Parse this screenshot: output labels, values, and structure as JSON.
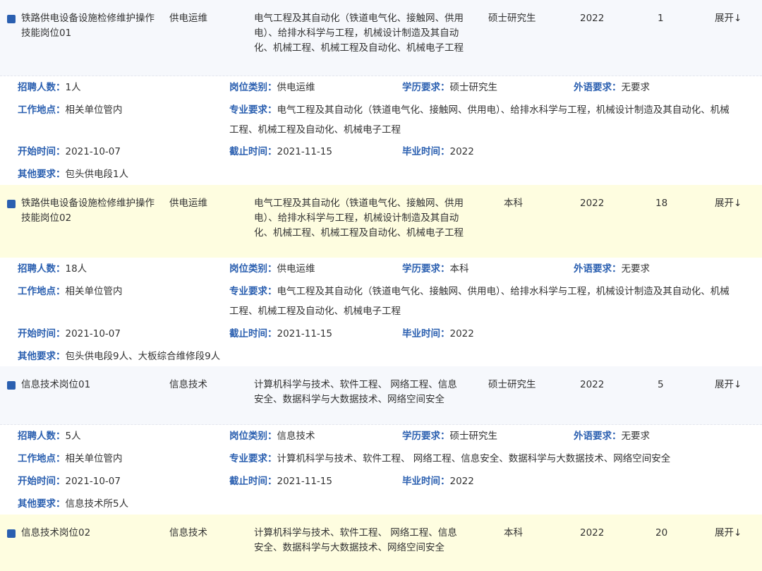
{
  "labels": {
    "recruit_count": "招聘人数：",
    "category": "岗位类别：",
    "education": "学历要求：",
    "foreign_lang": "外语要求：",
    "location": "工作地点：",
    "major": "专业要求：",
    "start": "开始时间：",
    "end": "截止时间：",
    "grad": "毕业时间：",
    "other": "其他要求：",
    "expand": "展开↓"
  },
  "jobs": [
    {
      "name": "铁路供电设备设施检修维护操作技能岗位01",
      "category": "供电运维",
      "major_short": "电气工程及其自动化（铁道电气化、接触网、供用电）、给排水科学与工程，机械设计制造及其自动化、机械工程、机械工程及自动化、机械电子工程",
      "education": "硕士研究生",
      "year": "2022",
      "count": "1",
      "d_count": "1人",
      "d_category": "供电运维",
      "d_education": "硕士研究生",
      "d_lang": "无要求",
      "d_location": "相关单位管内",
      "d_major": "电气工程及其自动化（铁道电气化、接触网、供用电）、给排水科学与工程，机械设计制造及其自动化、机械工程、机械工程及自动化、机械电子工程",
      "d_start": "2021-10-07",
      "d_end": "2021-11-15",
      "d_grad": "2022",
      "d_other": "包头供电段1人"
    },
    {
      "name": "铁路供电设备设施检修维护操作技能岗位02",
      "category": "供电运维",
      "major_short": "电气工程及其自动化（铁道电气化、接触网、供用电）、给排水科学与工程，机械设计制造及其自动化、机械工程、机械工程及自动化、机械电子工程",
      "education": "本科",
      "year": "2022",
      "count": "18",
      "d_count": "18人",
      "d_category": "供电运维",
      "d_education": "本科",
      "d_lang": "无要求",
      "d_location": "相关单位管内",
      "d_major": "电气工程及其自动化（铁道电气化、接触网、供用电）、给排水科学与工程，机械设计制造及其自动化、机械工程、机械工程及自动化、机械电子工程",
      "d_start": "2021-10-07",
      "d_end": "2021-11-15",
      "d_grad": "2022",
      "d_other": "包头供电段9人、大板综合维修段9人"
    },
    {
      "name": "信息技术岗位01",
      "category": "信息技术",
      "major_short": "计算机科学与技术、软件工程、 网络工程、信息安全、数据科学与大数据技术、网络空间安全",
      "education": "硕士研究生",
      "year": "2022",
      "count": "5",
      "d_count": "5人",
      "d_category": "信息技术",
      "d_education": "硕士研究生",
      "d_lang": "无要求",
      "d_location": "相关单位管内",
      "d_major": "计算机科学与技术、软件工程、 网络工程、信息安全、数据科学与大数据技术、网络空间安全",
      "d_start": "2021-10-07",
      "d_end": "2021-11-15",
      "d_grad": "2022",
      "d_other": "信息技术所5人"
    },
    {
      "name": "信息技术岗位02",
      "category": "信息技术",
      "major_short": "计算机科学与技术、软件工程、 网络工程、信息安全、数据科学与大数据技术、网络空间安全",
      "education": "本科",
      "year": "2022",
      "count": "20"
    }
  ]
}
